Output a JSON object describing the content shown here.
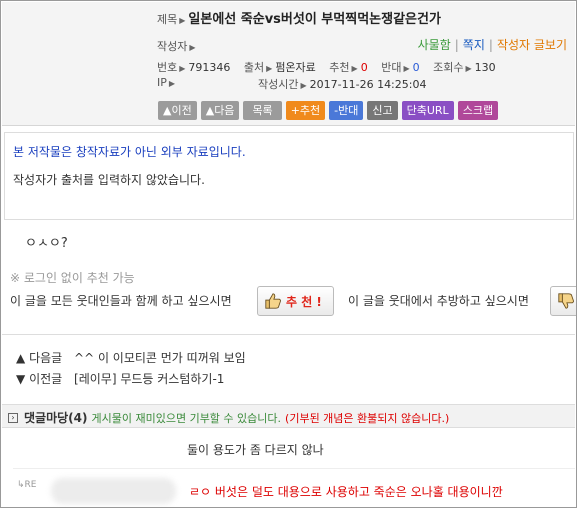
{
  "header": {
    "title_label": "제목",
    "title": "일본에선 죽순vs버섯이 부먹찍먹논쟁같은건가",
    "author_label": "작성자",
    "author_links": [
      "사물함",
      "쪽지",
      "작성자 글보기"
    ],
    "no_label": "번호",
    "no_value": "791346",
    "source_label": "출처",
    "source_value": "펌온자료",
    "recommend_label": "추천",
    "recommend_value": "0",
    "oppose_label": "반대",
    "oppose_value": "0",
    "views_label": "조회수",
    "views_value": "130",
    "ip_label": "IP",
    "written_label": "작성시간",
    "written_value": "2017-11-26 14:25:04"
  },
  "buttons": [
    "이전",
    "다음",
    "목록",
    "+추천",
    "-반대",
    "신고",
    "단축URL",
    "스크랩"
  ],
  "notice": {
    "line1": "본 저작물은 창작자료가 아닌 외부 자료입니다.",
    "line2": "작성자가 출처를 입력하지 않았습니다."
  },
  "body_text": "ㅇㅅㅇ?",
  "recommend_area": {
    "no_login": "※ 로그인 없이 추천 가능",
    "left_text": "이 글을 모든 웃대인들과 함께 하고 싶으시면",
    "recommend_button": "추 천 !",
    "right_text": "이 글을 웃대에서 추방하고 싶으시면"
  },
  "nav": {
    "next_label": "다음글",
    "next_title": "^^ 이 이모티콘 먼가 띠꺼워 보임",
    "prev_label": "이전글",
    "prev_title": "[레이무] 무드등 커스텀하기-1"
  },
  "comments": {
    "title": "댓글마당",
    "count": "(4)",
    "desc": "게시물이 재미있으면 기부할 수 있습니다.",
    "warning": "(기부된 개념은 환불되지 않습니다.)",
    "items": [
      {
        "text": "둘이 용도가 좀 다르지 않나"
      },
      {
        "reply_mark": "RE",
        "text": "ㄹㅇ 버섯은 덜도 대용으로 사용하고 죽순은 오나홀 대용이니깐"
      }
    ]
  },
  "colors": {
    "recommend_orange": "#f08a1c",
    "oppose_blue": "#4a78d8",
    "notice_blue": "#1a3fbf",
    "warning_red": "#d00000"
  }
}
